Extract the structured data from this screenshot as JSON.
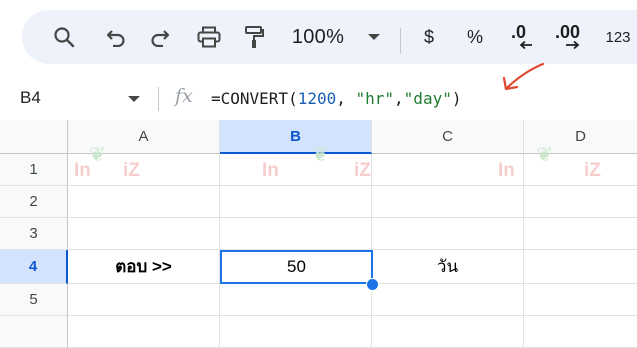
{
  "toolbar": {
    "zoom": "100%",
    "currency": "$",
    "percent": "%",
    "decrease_decimal": ".0",
    "increase_decimal": ".00",
    "more_formats": "123"
  },
  "formula_bar": {
    "name_box": "B4",
    "fx_label": "fx",
    "formula_prefix": "=CONVERT(",
    "formula_num": "1200",
    "formula_sep1": ", ",
    "formula_str1": "\"hr\"",
    "formula_sep2": ",",
    "formula_str2": "\"day\"",
    "formula_suffix": ")"
  },
  "sheet": {
    "columns": [
      "A",
      "B",
      "C",
      "D"
    ],
    "rows": [
      "1",
      "2",
      "3",
      "4",
      "5"
    ],
    "selected_column": "B",
    "selected_row": "4",
    "cells": {
      "A4": "ตอบ >>",
      "B4": "50",
      "C4": "วัน"
    }
  },
  "watermark": {
    "text_left": "In",
    "text_right": "iZ"
  },
  "colors": {
    "accent": "#1a73e8",
    "selection_header": "#d3e3fd",
    "toolbar_bg": "#edf2fb",
    "annotation_arrow": "#e0482f"
  }
}
